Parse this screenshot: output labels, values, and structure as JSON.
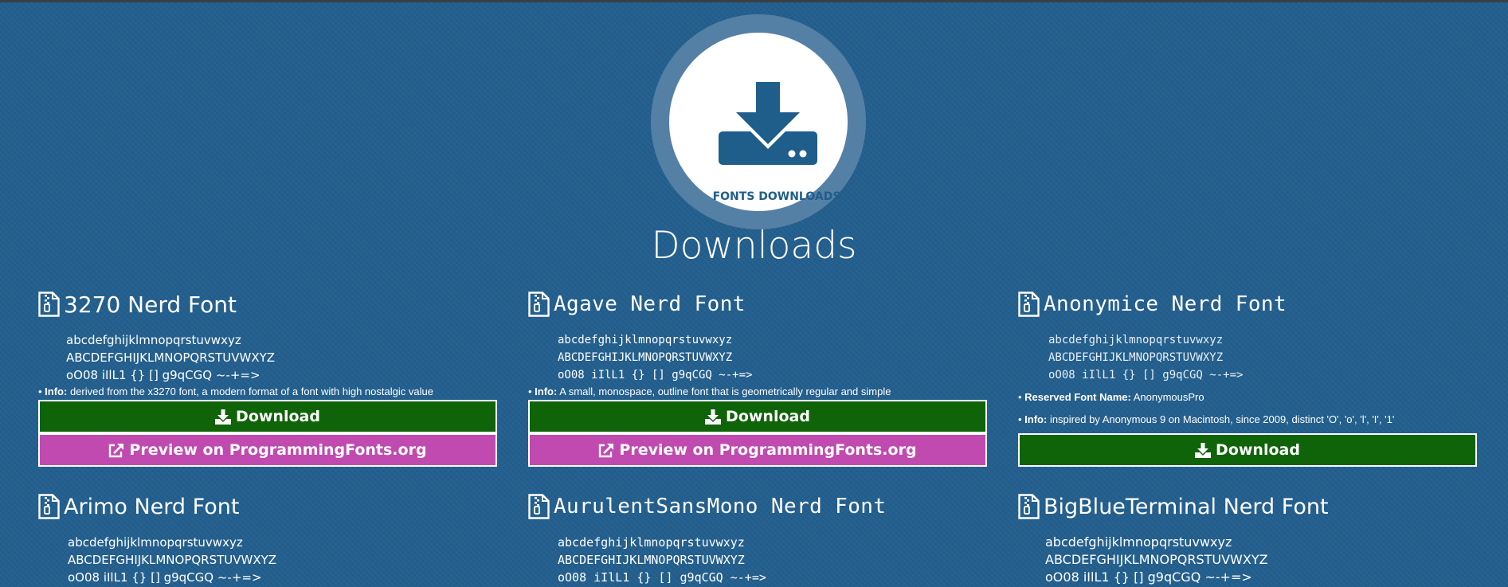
{
  "hero": {
    "caption": "FONTS DOWNLOADS",
    "title": "Downloads"
  },
  "colors": {
    "background": "#235f8e",
    "download": "#0f6308",
    "preview": "#c04ab0"
  },
  "icons": {
    "archive": "file-zip-icon",
    "download": "download-icon",
    "external": "external-link-icon"
  },
  "cards": [
    {
      "title": "3270 Nerd Font",
      "sample": [
        "abcdefghijklmnopqrstuvwxyz",
        "ABCDEFGHIJKLMNOPQRSTUVWXYZ",
        "oO08 iIlL1 {} [] g9qCGQ ~-+=>"
      ],
      "info_label": "Info:",
      "info_text": " derived from the x3270 font, a modern format of a font with high nostalgic value",
      "download_label": "Download",
      "preview_label": "Preview on ProgrammingFonts.org"
    },
    {
      "title": "Agave Nerd Font",
      "sample": [
        "abcdefghijklmnopqrstuvwxyz",
        "ABCDEFGHIJKLMNOPQRSTUVWXYZ",
        "oO08 iIlL1 {} [] g9qCGQ ~-+=>"
      ],
      "info_label": "Info:",
      "info_text": " A small, monospace, outline font that is geometrically regular and simple",
      "download_label": "Download",
      "preview_label": "Preview on ProgrammingFonts.org"
    },
    {
      "title": "Anonymice Nerd Font",
      "sample": [
        "abcdefghijklmnopqrstuvwxyz",
        "ABCDEFGHIJKLMNOPQRSTUVWXYZ",
        "oO08 iIlL1 {} [] g9qCGQ ~-+=>"
      ],
      "reserved_label": "Reserved Font Name:",
      "reserved_text": " AnonymousPro",
      "info_label": "Info:",
      "info_text": " inspired by Anonymous 9 on Macintosh, since 2009, distinct 'O', 'o', 'l', 'I', '1'",
      "download_label": "Download"
    },
    {
      "title": "Arimo Nerd Font",
      "sample": [
        "abcdefghijklmnopqrstuvwxyz",
        "ABCDEFGHIJKLMNOPQRSTUVWXYZ",
        "oO08 iIlL1 {} [] g9qCGQ ~-+=>"
      ]
    },
    {
      "title": "AurulentSansMono Nerd Font",
      "sample": [
        "abcdefghijklmnopqrstuvwxyz",
        "ABCDEFGHIJKLMNOPQRSTUVWXYZ",
        "oO08 iIlL1 {} [] g9qCGQ ~-+=>"
      ]
    },
    {
      "title": "BigBlueTerminal Nerd Font",
      "sample": [
        "abcdefghijklmnopqrstuvwxyz",
        "ABCDEFGHIJKLMNOPQRSTUVWXYZ",
        "oO08 iIlL1 {} [] g9qCGQ ~-+=>"
      ]
    }
  ]
}
